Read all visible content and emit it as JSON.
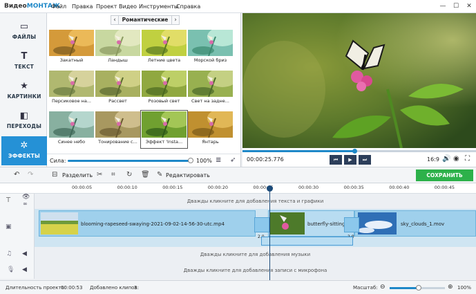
{
  "app": {
    "logo_a": "Видео",
    "logo_b": "МОНТАЖ"
  },
  "menu": [
    "Файл",
    "Правка",
    "Проект",
    "Видео",
    "Инструменты",
    "Справка"
  ],
  "sidebar": [
    {
      "label": "ФАЙЛЫ",
      "icon": "folder-icon"
    },
    {
      "label": "ТЕКСТ",
      "icon": "text-icon"
    },
    {
      "label": "КАРТИНКИ",
      "icon": "star-icon"
    },
    {
      "label": "ПЕРЕХОДЫ",
      "icon": "transitions-icon"
    },
    {
      "label": "ЭФФЕКТЫ",
      "icon": "effects-wand-icon",
      "active": true
    }
  ],
  "category": "Романтические",
  "effects": [
    {
      "label": "Закатный"
    },
    {
      "label": "Ландыш"
    },
    {
      "label": "Летние цвета"
    },
    {
      "label": "Морской бриз"
    },
    {
      "label": "Персиковое на..."
    },
    {
      "label": "Рассвет"
    },
    {
      "label": "Розовый свет"
    },
    {
      "label": "Свет на задне..."
    },
    {
      "label": "Синее небо"
    },
    {
      "label": "Тонирование с..."
    },
    {
      "label": "Эффект 'Insta...",
      "selected": true
    },
    {
      "label": "Янтарь"
    }
  ],
  "strength": {
    "label": "Сила:",
    "value": "100%",
    "fraction": 1.0
  },
  "player": {
    "time": "00:00:25.776",
    "aspect": "16:9",
    "progress": 0.48
  },
  "toolbar": {
    "split": "Разделить",
    "edit": "Редактировать",
    "save": "СОХРАНИТЬ ВИДЕО"
  },
  "ruler": [
    "00:00:05",
    "00:00:10",
    "00:00:15",
    "00:00:20",
    "00:00:25",
    "00:00:30",
    "00:00:35",
    "00:00:40",
    "00:00:45"
  ],
  "timeline": {
    "text_hint": "Дважды кликните для добавления текста и графики",
    "music_hint": "Дважды кликните для добавления музыки",
    "mic_hint": "Дважды кликните для добавления записи с микрофона",
    "clips": [
      "blooming-rapeseed-swaying-2021-09-02-14-56-30-utc.mp4",
      "butterfly-sitting-o",
      "sky_clouds_1.mov"
    ],
    "transition_a": "2.0",
    "transition_b": "2.0"
  },
  "status": {
    "duration_label": "Длительность проекта:",
    "duration": "00:00:53",
    "clips_label": "Добавлено клипов:",
    "clips": "3",
    "zoom_label": "Масштаб:",
    "zoom": "100%",
    "zoom_fraction": 0.52
  }
}
